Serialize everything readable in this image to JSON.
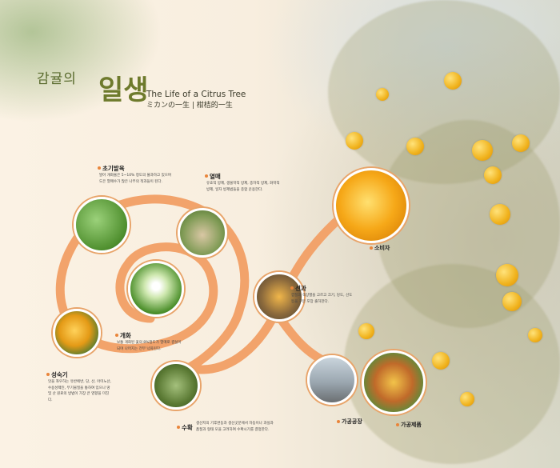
{
  "title": {
    "ko_small": "감귤의",
    "ko_big": "일생",
    "en": "The Life of a Citrus Tree",
    "jp": "ミカンの一生 | 柑桔的一生"
  },
  "stages": {
    "early_growth": {
      "label": "초기발육",
      "desc": "발아 개화율은 5~10% 정도의 불과하고 있으며도은 열매수가 많은 나무의 적과들이 된다."
    },
    "flowering": {
      "label": "개화",
      "desc": "보통 개화된 꽃의 8%정도가 열매로 결실이 되며 나머지는 전부 낙화된다."
    },
    "fruit_set": {
      "label": "열매",
      "desc": "유효적 방제, 생물학적 방제, 종자적 방제, 화학적 방제, 일자 방제법들을 종합 운용한다."
    },
    "ripening": {
      "label": "성숙기",
      "desc": "맛을 좌우하는 유반에반, 당, 산, 아미노산, 수용성펙틴, 무기물질을 통하여 있으나 땅 및 산 원료의 방법이 가장 큰 영향을 미친다."
    },
    "harvest": {
      "label": "수확",
      "desc": "생산지의 기후변동과 생산곳분에서 자동이나 과실과 품질과 형태 모을 고려하여 수확시기를 결정한다."
    },
    "sorting": {
      "label": "선과",
      "desc": "껍질과 색상별을 고르고 크기, 당도, 선도등을 구분 포장 출하한다."
    },
    "consumer": {
      "label": "소비자"
    },
    "factory": {
      "label": "가공공장"
    },
    "products": {
      "label": "가공제품"
    }
  }
}
